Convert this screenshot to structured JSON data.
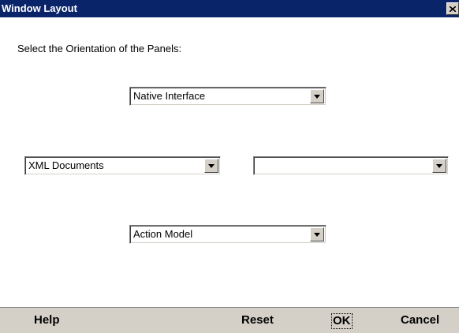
{
  "window": {
    "title": "Window Layout"
  },
  "prompt": "Select the Orientation of the Panels:",
  "panels": {
    "top": {
      "value": "Native Interface"
    },
    "left": {
      "value": "XML Documents"
    },
    "right": {
      "value": ""
    },
    "bottom": {
      "value": "Action Model"
    }
  },
  "buttons": {
    "help": "Help",
    "reset": "Reset",
    "ok": "OK",
    "cancel": "Cancel"
  },
  "icons": {
    "close": "close-icon",
    "dropdown": "chevron-down-icon"
  },
  "colors": {
    "titlebar": "#0a246a",
    "button_face": "#d4d0c8"
  }
}
